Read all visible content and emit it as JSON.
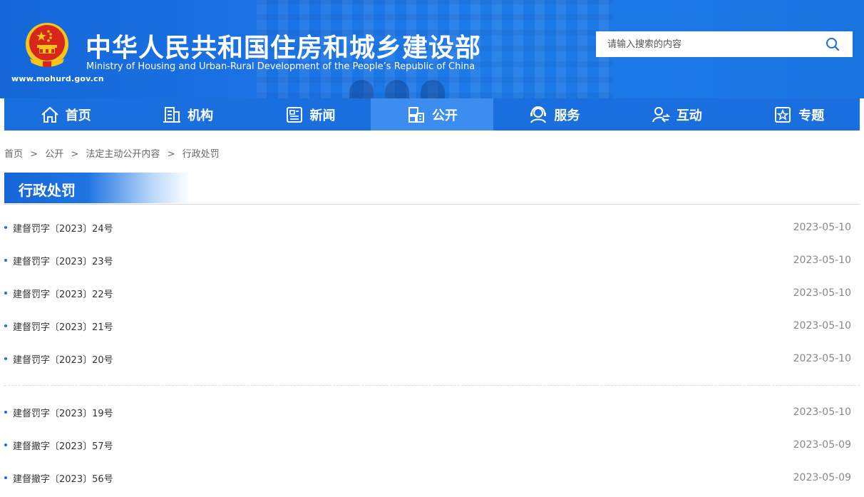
{
  "header": {
    "title_cn": "中华人民共和国住房和城乡建设部",
    "title_en": "Ministry of Housing and Urban-Rural Development of the People’s Republic of China",
    "site_url": "www.mohurd.gov.cn"
  },
  "search": {
    "placeholder": "请输入搜索的内容",
    "value": ""
  },
  "nav": {
    "items": [
      {
        "label": "首页",
        "icon": "home-icon"
      },
      {
        "label": "机构",
        "icon": "building-icon"
      },
      {
        "label": "新闻",
        "icon": "newspaper-icon"
      },
      {
        "label": "公开",
        "icon": "disclosure-icon",
        "active": true
      },
      {
        "label": "服务",
        "icon": "service-icon"
      },
      {
        "label": "互动",
        "icon": "interact-icon"
      },
      {
        "label": "专题",
        "icon": "topic-icon"
      }
    ]
  },
  "breadcrumb": {
    "home": "首页",
    "open": "公开",
    "legal": "法定主动公开内容",
    "current": "行政处罚",
    "separator": ">"
  },
  "section": {
    "title": "行政处罚"
  },
  "list": {
    "group1": [
      {
        "title": "建督罚字〔2023〕24号",
        "date": "2023-05-10"
      },
      {
        "title": "建督罚字〔2023〕23号",
        "date": "2023-05-10"
      },
      {
        "title": "建督罚字〔2023〕22号",
        "date": "2023-05-10"
      },
      {
        "title": "建督罚字〔2023〕21号",
        "date": "2023-05-10"
      },
      {
        "title": "建督罚字〔2023〕20号",
        "date": "2023-05-10"
      }
    ],
    "group2": [
      {
        "title": "建督罚字〔2023〕19号",
        "date": "2023-05-10"
      },
      {
        "title": "建督撤字〔2023〕57号",
        "date": "2023-05-09"
      },
      {
        "title": "建督撤字〔2023〕56号",
        "date": "2023-05-09"
      }
    ]
  },
  "colors": {
    "brand_blue": "#1a6fdf",
    "active_nav": "#3d8df0",
    "emblem_red": "#d8261c",
    "emblem_gold": "#f5c518"
  }
}
